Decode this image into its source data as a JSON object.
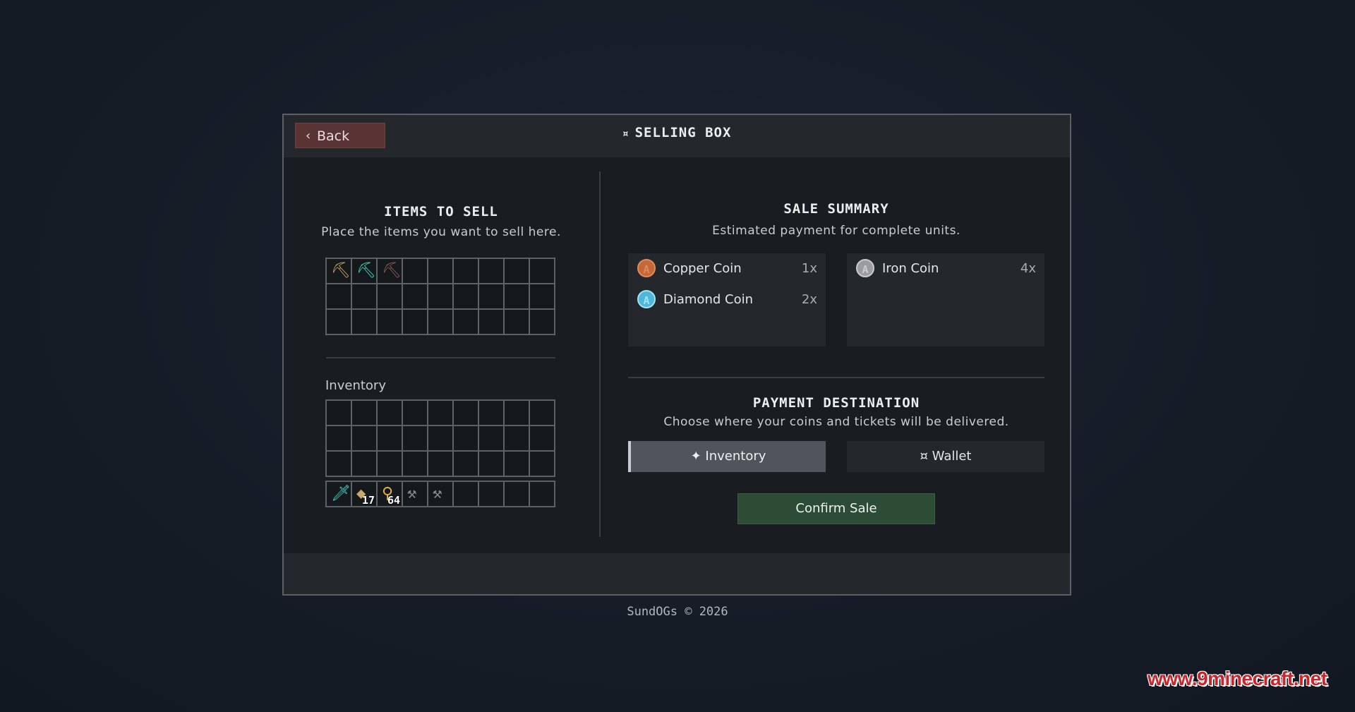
{
  "header": {
    "back_label": "Back",
    "back_icon": "chevron-left-icon",
    "title": "SELLING BOX",
    "title_icon": "ticket-icon"
  },
  "sell_section": {
    "title": "ITEMS TO SELL",
    "subtitle": "Place the items you want to sell here.",
    "slots": [
      {
        "item": "wooden-pickaxe",
        "glyph": "⛏",
        "color": "#c9a061",
        "count": ""
      },
      {
        "item": "diamond-pickaxe",
        "glyph": "⛏",
        "color": "#3fd6c0",
        "count": ""
      },
      {
        "item": "netherite-pickaxe",
        "glyph": "⛏",
        "color": "#8a5a5a",
        "count": ""
      },
      {},
      {},
      {},
      {},
      {},
      {},
      {},
      {},
      {},
      {},
      {},
      {},
      {},
      {},
      {},
      {},
      {},
      {},
      {},
      {},
      {},
      {},
      {},
      {}
    ]
  },
  "inventory": {
    "label": "Inventory",
    "main_slots": [
      {},
      {},
      {},
      {},
      {},
      {},
      {},
      {},
      {},
      {},
      {},
      {},
      {},
      {},
      {},
      {},
      {},
      {},
      {},
      {},
      {},
      {},
      {},
      {},
      {},
      {},
      {}
    ],
    "hotbar": [
      {
        "item": "diamond-sword",
        "glyph": "🗡",
        "color": "#3fd6c0",
        "count": ""
      },
      {
        "item": "bread",
        "glyph": "◆",
        "color": "#c9a96a",
        "count": "17"
      },
      {
        "item": "torch",
        "glyph": "⚲",
        "color": "#e0b050",
        "count": "64"
      },
      {
        "item": "stone-shovel",
        "glyph": "⚒",
        "color": "#8a8a8a",
        "count": ""
      },
      {
        "item": "stone-shovel",
        "glyph": "⚒",
        "color": "#8a8a8a",
        "count": ""
      },
      {},
      {},
      {},
      {}
    ]
  },
  "summary": {
    "title": "SALE SUMMARY",
    "subtitle": "Estimated payment for complete units.",
    "coins": [
      {
        "name": "Copper Coin",
        "qty": "1x",
        "icon": "copper-coin-icon",
        "color": "#c4683c",
        "ring": "#e38a5a"
      },
      {
        "name": "Iron Coin",
        "qty": "4x",
        "icon": "iron-coin-icon",
        "color": "#9a9ca0",
        "ring": "#c8cacd"
      },
      {
        "name": "Diamond Coin",
        "qty": "2x",
        "icon": "diamond-coin-icon",
        "color": "#4fb8d8",
        "ring": "#9fe4f4"
      },
      {
        "name": "",
        "qty": ""
      },
      {
        "name": "",
        "qty": ""
      },
      {
        "name": "",
        "qty": ""
      }
    ]
  },
  "payment": {
    "title": "PAYMENT DESTINATION",
    "subtitle": "Choose where your coins and tickets will be delivered.",
    "inventory_label": "✦ Inventory",
    "wallet_label": "¤ Wallet",
    "selected": "inventory",
    "confirm_label": "Confirm Sale"
  },
  "footer": {
    "copyright": "SundOGs © 2026"
  },
  "watermark": "www.9minecraft.net",
  "colors": {
    "back_button": "#5a3434",
    "confirm_button": "#2d4c35",
    "selected_destination": "#50555c"
  }
}
